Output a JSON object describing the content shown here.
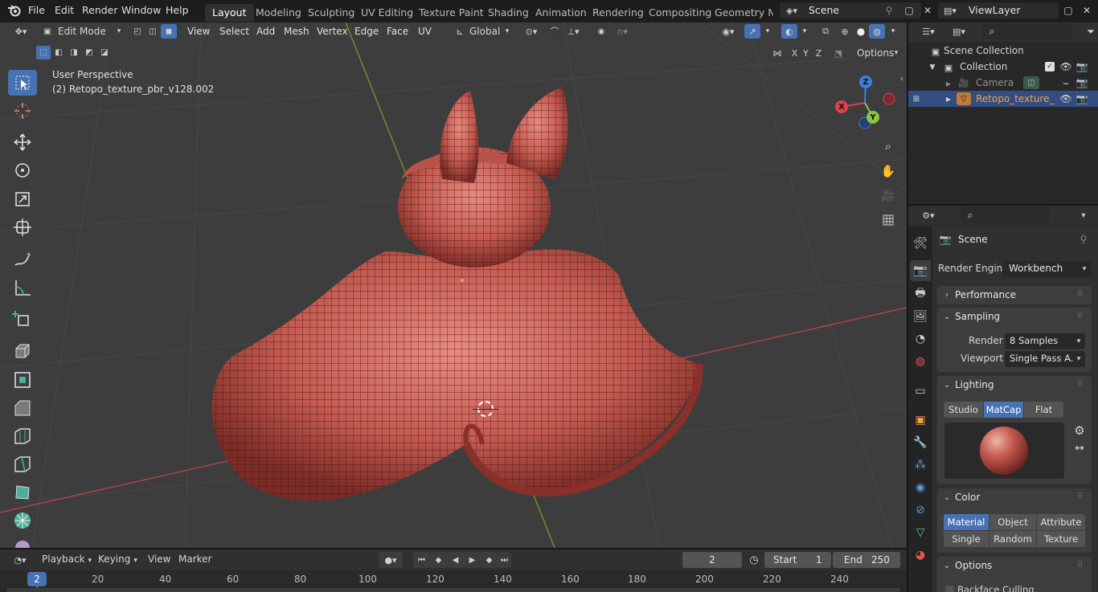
{
  "menus": [
    "File",
    "Edit",
    "Render",
    "Window",
    "Help"
  ],
  "workspaces": [
    "Layout",
    "Modeling",
    "Sculpting",
    "UV Editing",
    "Texture Paint",
    "Shading",
    "Animation",
    "Rendering",
    "Compositing",
    "Geometry Noc"
  ],
  "active_workspace": "Layout",
  "scene_name": "Scene",
  "view_layer": "ViewLayer",
  "viewport_header": {
    "mode": "Edit Mode",
    "menus": [
      "View",
      "Select",
      "Add",
      "Mesh",
      "Vertex",
      "Edge",
      "Face",
      "UV"
    ],
    "transform_orientation": "Global",
    "options_label": "Options",
    "axes": [
      "X",
      "Y",
      "Z"
    ]
  },
  "viewport": {
    "perspective": "User Perspective",
    "object_label": "(2) Retopo_texture_pbr_v128.002",
    "gizmo": {
      "x": "X",
      "y": "Y",
      "z": "Z"
    }
  },
  "outliner": {
    "root": "Scene Collection",
    "collection": "Collection",
    "items": [
      {
        "name": "Camera"
      },
      {
        "name": "Retopo_texture_"
      }
    ]
  },
  "properties": {
    "tab_title": "Scene",
    "render_engine_label": "Render Engine",
    "render_engine": "Workbench",
    "performance": "Performance",
    "sampling": {
      "title": "Sampling",
      "render_label": "Render",
      "render_value": "8 Samples",
      "viewport_label": "Viewport",
      "viewport_value": "Single Pass A..."
    },
    "lighting": {
      "title": "Lighting",
      "options": [
        "Studio",
        "MatCap",
        "Flat"
      ],
      "active": "MatCap"
    },
    "color": {
      "title": "Color",
      "row1": [
        "Material",
        "Object",
        "Attribute"
      ],
      "row2": [
        "Single",
        "Random",
        "Texture"
      ],
      "active": "Material"
    },
    "options": {
      "title": "Options",
      "backface": "Backface Culling"
    }
  },
  "timeline": {
    "menus": [
      "Playback",
      "Keying",
      "View",
      "Marker"
    ],
    "current_frame": "2",
    "start_label": "Start",
    "start": "1",
    "end_label": "End",
    "end": "250",
    "ticks": [
      "20",
      "40",
      "60",
      "80",
      "100",
      "120",
      "140",
      "160",
      "180",
      "200",
      "220",
      "240"
    ],
    "playhead": "2"
  },
  "colors": {
    "accent": "#4772b3",
    "mesh": "#c8554c",
    "selected": "#f0a04b",
    "x_axis": "#e0404f",
    "y_axis": "#8cc63e",
    "z_axis": "#3d80e0"
  }
}
